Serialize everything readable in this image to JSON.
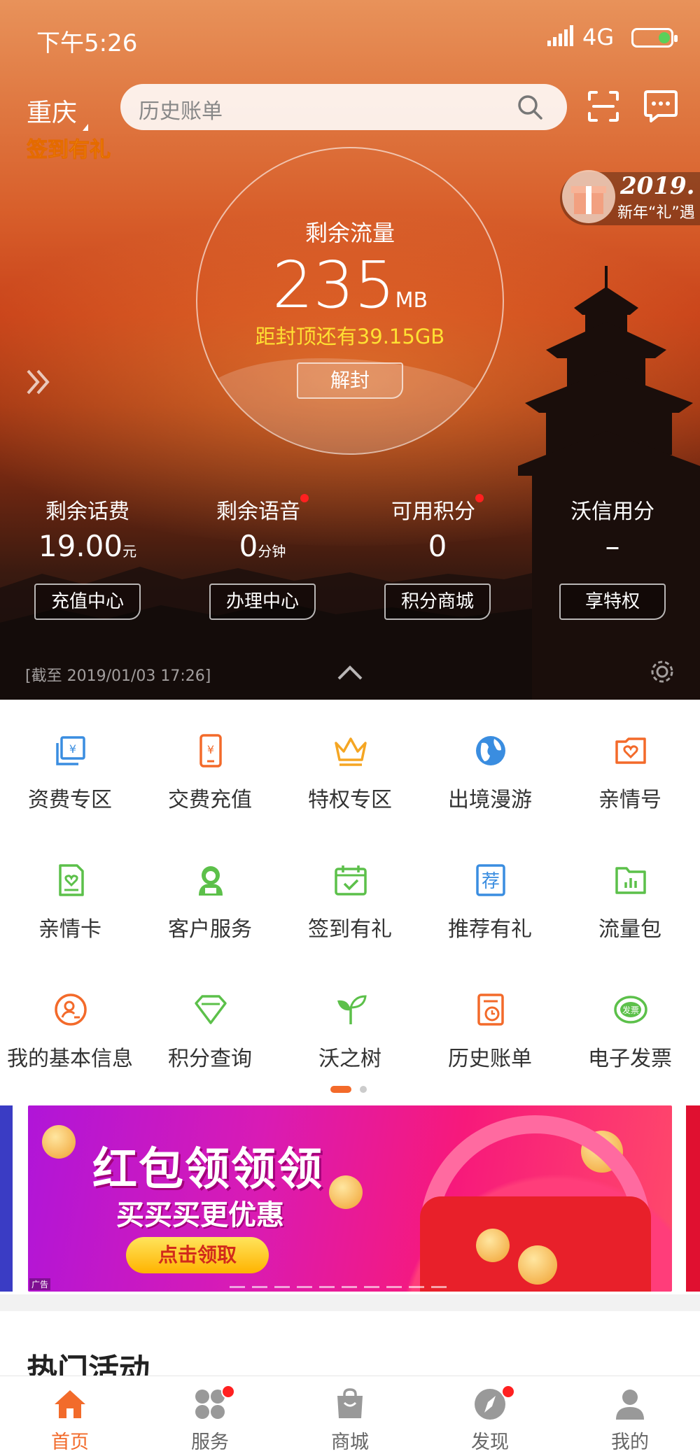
{
  "status_bar": {
    "time": "下午5:26",
    "network": "4G"
  },
  "header": {
    "city": "重庆",
    "search_placeholder": "历史账单",
    "signin_badge": "签到有礼",
    "promo": {
      "year": "2019.",
      "text": "新年“礼”遇"
    }
  },
  "traffic": {
    "label": "剩余流量",
    "value": "235",
    "unit": "MB",
    "cap_text": "距封顶还有39.15GB",
    "button": "解封"
  },
  "stats": [
    {
      "title": "剩余话费",
      "value": "19.00",
      "unit": "元",
      "button": "充值中心",
      "has_dot": false
    },
    {
      "title": "剩余语音",
      "value": "0",
      "unit": "分钟",
      "button": "办理中心",
      "has_dot": true
    },
    {
      "title": "可用积分",
      "value": "0",
      "unit": "",
      "button": "积分商城",
      "has_dot": true
    },
    {
      "title": "沃信用分",
      "value": "–",
      "unit": "",
      "button": "享特权",
      "has_dot": false
    }
  ],
  "as_of": "[截至 2019/01/03 17:26]",
  "services": [
    {
      "label": "资费专区",
      "icon": "tariff-icon",
      "color": "#3a8de0"
    },
    {
      "label": "交费充值",
      "icon": "phone-recharge-icon",
      "color": "#f36a2a"
    },
    {
      "label": "特权专区",
      "icon": "crown-icon",
      "color": "#f5a623"
    },
    {
      "label": "出境漫游",
      "icon": "globe-icon",
      "color": "#3a8de0"
    },
    {
      "label": "亲情号",
      "icon": "family-card-icon",
      "color": "#f36a2a"
    },
    {
      "label": "亲情卡",
      "icon": "sim-heart-icon",
      "color": "#5cc04a"
    },
    {
      "label": "客户服务",
      "icon": "customer-service-icon",
      "color": "#5cc04a"
    },
    {
      "label": "签到有礼",
      "icon": "calendar-check-icon",
      "color": "#5cc04a"
    },
    {
      "label": "推荐有礼",
      "icon": "recommend-icon",
      "color": "#3a8de0"
    },
    {
      "label": "流量包",
      "icon": "data-folder-icon",
      "color": "#5cc04a"
    },
    {
      "label": "我的基本信息",
      "icon": "user-info-icon",
      "color": "#f36a2a"
    },
    {
      "label": "积分查询",
      "icon": "diamond-icon",
      "color": "#5cc04a"
    },
    {
      "label": "沃之树",
      "icon": "sprout-icon",
      "color": "#5cc04a"
    },
    {
      "label": "历史账单",
      "icon": "bill-history-icon",
      "color": "#f36a2a"
    },
    {
      "label": "电子发票",
      "icon": "e-invoice-icon",
      "color": "#5cc04a"
    }
  ],
  "banner": {
    "headline": "红包领领领",
    "subline": "买买买更优惠",
    "cta": "点击领取",
    "ad_tag": "广告",
    "invoice_icon_text": "发票"
  },
  "section_title": "热门活动",
  "tabs": [
    {
      "label": "首页",
      "icon": "home-icon",
      "active": true,
      "has_dot": false
    },
    {
      "label": "服务",
      "icon": "services-icon",
      "active": false,
      "has_dot": true
    },
    {
      "label": "商城",
      "icon": "shopping-bag-icon",
      "active": false,
      "has_dot": false
    },
    {
      "label": "发现",
      "icon": "compass-icon",
      "active": false,
      "has_dot": true
    },
    {
      "label": "我的",
      "icon": "profile-icon",
      "active": false,
      "has_dot": false
    }
  ],
  "colors": {
    "accent": "#f26b2b",
    "yellow": "#ffe033",
    "dot": "#ff2020"
  }
}
